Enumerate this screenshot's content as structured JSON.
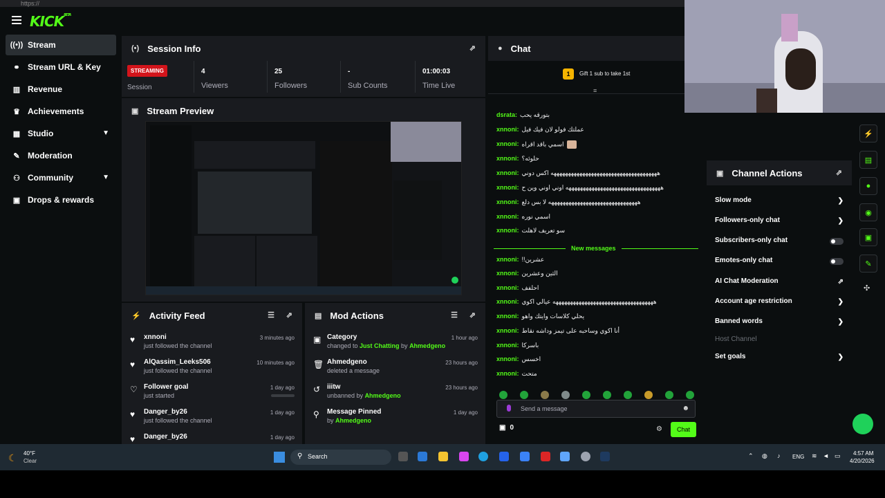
{
  "app": {
    "logo": "KICK",
    "logo_tag": "BETA"
  },
  "sidebar": {
    "items": [
      {
        "label": "Stream",
        "icon": "broadcast-icon"
      },
      {
        "label": "Stream URL & Key",
        "icon": "link-icon"
      },
      {
        "label": "Revenue",
        "icon": "chart-icon"
      },
      {
        "label": "Achievements",
        "icon": "trophy-icon"
      },
      {
        "label": "Studio",
        "icon": "film-icon"
      },
      {
        "label": "Moderation",
        "icon": "wrench-icon"
      },
      {
        "label": "Community",
        "icon": "users-icon"
      },
      {
        "label": "Drops & rewards",
        "icon": "gift-icon"
      }
    ]
  },
  "session": {
    "title": "Session Info",
    "badge": "STREAMING",
    "session_label": "Session",
    "stats": [
      {
        "value": "4",
        "label": "Viewers"
      },
      {
        "value": "25",
        "label": "Followers"
      },
      {
        "value": "-",
        "label": "Sub Counts"
      },
      {
        "value": "01:00:03",
        "label": "Time Live"
      }
    ]
  },
  "preview": {
    "title": "Stream Preview"
  },
  "activity": {
    "title": "Activity Feed",
    "rows": [
      {
        "name": "xnnoni",
        "sub": "just followed the channel",
        "time": "3 minutes ago",
        "icon": "heart-icon"
      },
      {
        "name": "AlQassim_Leeks506",
        "sub": "just followed the channel",
        "time": "10 minutes ago",
        "icon": "heart-icon"
      },
      {
        "name": "Follower goal",
        "sub": "just started",
        "time": "1 day ago",
        "icon": "heart-outline-icon"
      },
      {
        "name": "Danger_by26",
        "sub": "just followed the channel",
        "time": "1 day ago",
        "icon": "heart-icon"
      },
      {
        "name": "Danger_by26",
        "sub": "",
        "time": "1 day ago",
        "icon": "heart-icon"
      }
    ]
  },
  "mod": {
    "title": "Mod Actions",
    "rows": [
      {
        "name": "Category",
        "pre": "changed to ",
        "hl1": "Just Chatting",
        "mid": " by ",
        "hl2": "Ahmedgeno",
        "time": "1 hour ago"
      },
      {
        "name": "Ahmedgeno",
        "pre": "deleted a message",
        "hl1": "",
        "mid": "",
        "hl2": "",
        "time": "23 hours ago"
      },
      {
        "name": "iiitw",
        "pre": "unbanned by ",
        "hl1": "",
        "mid": "",
        "hl2": "Ahmedgeno",
        "time": "23 hours ago"
      },
      {
        "name": "Message Pinned",
        "pre": "by ",
        "hl1": "",
        "mid": "",
        "hl2": "Ahmedgeno",
        "time": "1 day ago"
      }
    ]
  },
  "chat": {
    "title": "Chat",
    "gift": "Gift 1 sub to take 1st",
    "gift_rank": "1",
    "lines": [
      {
        "user": "dsrata:",
        "msg": "بتورقه يحب"
      },
      {
        "user": "xnnoni:",
        "msg": "عملتك فولو لان فيك فيل"
      },
      {
        "user": "xnnoni:",
        "msg": "اسمي باقد اقراه"
      },
      {
        "user": "xnnoni:",
        "msg": "حلوئه؟"
      },
      {
        "user": "xnnoni:",
        "msg": "هههههههههههههههههههههههههههههههههههههه اكس دوني"
      },
      {
        "user": "xnnoni:",
        "msg": "هههههههههههههههههههههههههههههههههه اوني اوني وين ح"
      },
      {
        "user": "xnnoni:",
        "msg": "هههههههههههههههههههههههههههههههه لا بس دلع"
      },
      {
        "user": "xnnoni:",
        "msg": "اسمي نوره"
      },
      {
        "user": "xnnoni:",
        "msg": "سو تعريف لاهلت"
      }
    ],
    "new_messages": "New messages",
    "lines2": [
      {
        "user": "xnnoni:",
        "msg": "!!عشرين"
      },
      {
        "user": "xnnoni:",
        "msg": "الثين وعشرين"
      },
      {
        "user": "xnnoni:",
        "msg": "احلفف"
      },
      {
        "user": "xnnoni:",
        "msg": "هههههههههههههههههههههههههههههههههههه عيالي اكوي"
      },
      {
        "user": "xnnoni:",
        "msg": "يحلي كلاسات وايتك واهو"
      },
      {
        "user": "xnnoni:",
        "msg": "أنا اكوي وساحبه على تيمز وداشه نقاط"
      },
      {
        "user": "xnnoni:",
        "msg": "باسركا"
      },
      {
        "user": "xnnoni:",
        "msg": "اخسس"
      },
      {
        "user": "xnnoni:",
        "msg": "متحت"
      }
    ],
    "placeholder": "Send a message",
    "count": "0",
    "send": "Chat"
  },
  "channel_actions": {
    "title": "Channel Actions",
    "rows": [
      {
        "label": "Slow mode",
        "ctrl": "chevron"
      },
      {
        "label": "Followers-only chat",
        "ctrl": "chevron"
      },
      {
        "label": "Subscribers-only chat",
        "ctrl": "toggle"
      },
      {
        "label": "Emotes-only chat",
        "ctrl": "toggle"
      },
      {
        "label": "AI Chat Moderation",
        "ctrl": "external"
      },
      {
        "label": "Account age restriction",
        "ctrl": "chevron"
      },
      {
        "label": "Banned words",
        "ctrl": "chevron"
      },
      {
        "label": "Host Channel",
        "ctrl": "none"
      },
      {
        "label": "Set goals",
        "ctrl": "chevron"
      }
    ]
  },
  "taskbar": {
    "weather_temp": "40°F",
    "weather_desc": "Clear",
    "search": "Search",
    "lang": "ENG",
    "time": "4:57 AM",
    "date": "4/20/2026"
  },
  "colors": {
    "accent": "#53fc18",
    "live": "#d3141b",
    "panel": "#191b1f"
  }
}
